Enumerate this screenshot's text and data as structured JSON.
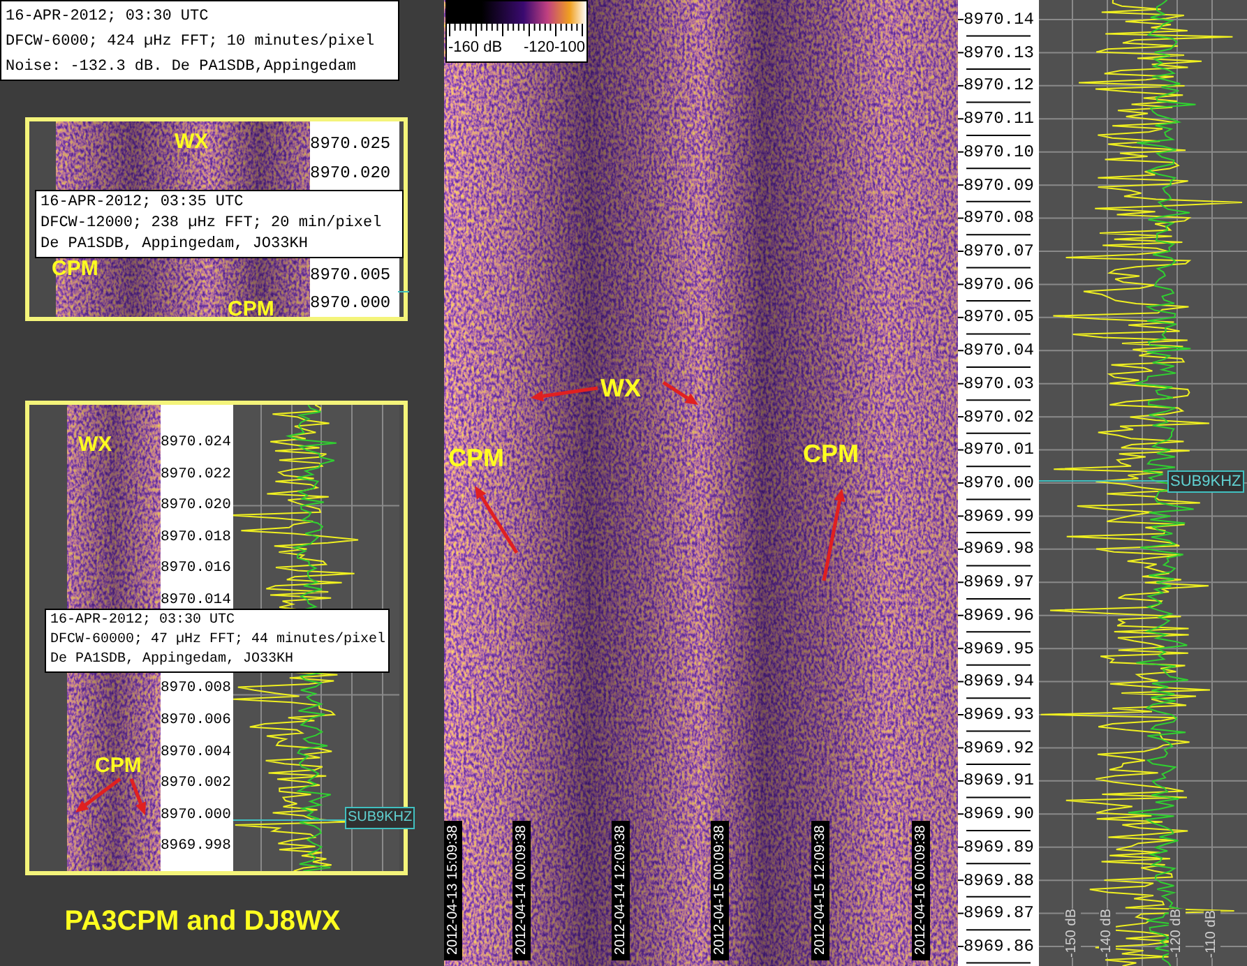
{
  "header": {
    "lines": [
      "16-APR-2012; 03:30 UTC",
      "DFCW-6000; 424 µHz FFT; 10 minutes/pixel",
      "Noise: -132.3 dB. De PA1SDB,Appingedam"
    ]
  },
  "colorbar": {
    "labels": [
      "-160 dB",
      "-120-100"
    ]
  },
  "inset_1": {
    "annotations": [
      "WX",
      "CPM",
      "CPM"
    ],
    "freq_labels": [
      "8970.025",
      "8970.020",
      "8970.005",
      "8970.000"
    ],
    "info_lines": [
      "16-APR-2012; 03:35 UTC",
      "DFCW-12000; 238 µHz FFT; 20 min/pixel",
      "De PA1SDB, Appingedam, JO33KH"
    ]
  },
  "inset_2": {
    "annotations": [
      "WX",
      "CPM"
    ],
    "freq_labels_upper": [
      "8970.024",
      "8970.022",
      "8970.020",
      "8970.018",
      "8970.016",
      "8970.014"
    ],
    "freq_labels_lower": [
      "8970.008",
      "8970.006",
      "8970.004",
      "8970.002",
      "8970.000",
      "8969.998"
    ],
    "info_lines": [
      "16-APR-2012; 03:30 UTC",
      "DFCW-60000; 47 µHz FFT; 44 minutes/pixel",
      "De PA1SDB, Appingedam, JO33KH"
    ],
    "marker": "SUB9KHZ"
  },
  "caption": "PA3CPM and DJ8WX",
  "main": {
    "annotations": [
      "WX",
      "CPM",
      "CPM"
    ],
    "time_labels": [
      "2012-04-13 15:09:38",
      "2012-04-14 00:09:38",
      "2012-04-14 12:09:38",
      "2012-04-15 00:09:38",
      "2012-04-15 12:09:38",
      "2012-04-16 00:09:38"
    ]
  },
  "right": {
    "freq_labels": [
      "8970.14",
      "8970.13",
      "8970.12",
      "8970.11",
      "8970.10",
      "8970.09",
      "8970.08",
      "8970.07",
      "8970.06",
      "8970.05",
      "8970.04",
      "8970.03",
      "8970.02",
      "8970.01",
      "8970.00",
      "8969.99",
      "8969.98",
      "8969.97",
      "8969.96",
      "8969.95",
      "8969.94",
      "8969.93",
      "8969.92",
      "8969.91",
      "8969.90",
      "8969.89",
      "8969.88",
      "8969.87",
      "8969.86"
    ],
    "marker": "SUB9KHZ",
    "db_labels": [
      "-150 dB",
      "-140 dB",
      "-120 dB",
      "-110 dB"
    ]
  }
}
